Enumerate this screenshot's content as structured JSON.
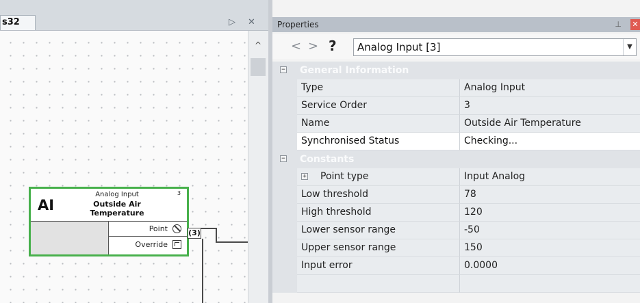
{
  "left_pane": {
    "doc_tab_label": "s32",
    "tab_menu_icon": "▷",
    "tab_close_icon": "✕",
    "scroll_up_icon": "^"
  },
  "block": {
    "abbr": "AI",
    "type": "Analog Input",
    "number": "3",
    "name_line1": "Outside Air",
    "name_line2": "Temperature",
    "pins": [
      {
        "label": "Point",
        "icon": "no-sign-icon"
      },
      {
        "label": "Override",
        "icon": "override-icon"
      }
    ],
    "ref_label": "(3)"
  },
  "properties": {
    "title": "Properties",
    "pin_icon": "⊥",
    "close_icon": "✕",
    "nav_back": "<",
    "nav_forward": ">",
    "nav_help": "?",
    "selected_object": "Analog Input [3]",
    "selector_arrow": "▼",
    "categories": [
      {
        "label": "General Information",
        "toggle": "−",
        "rows": [
          {
            "name": "Type",
            "value": "Analog Input"
          },
          {
            "name": "Service Order",
            "value": "3"
          },
          {
            "name": "Name",
            "value": "Outside Air Temperature"
          },
          {
            "name": "Synchronised Status",
            "value": "Checking..."
          }
        ]
      },
      {
        "label": "Constants",
        "toggle": "−",
        "rows": [
          {
            "name": "Point type",
            "value": "Input  Analog",
            "toggle": "+"
          },
          {
            "name": "Low threshold",
            "value": "78"
          },
          {
            "name": "High threshold",
            "value": "120"
          },
          {
            "name": "Lower sensor range",
            "value": "-50"
          },
          {
            "name": "Upper sensor range",
            "value": "150"
          },
          {
            "name": "Input error",
            "value": "0.0000"
          }
        ]
      }
    ]
  }
}
